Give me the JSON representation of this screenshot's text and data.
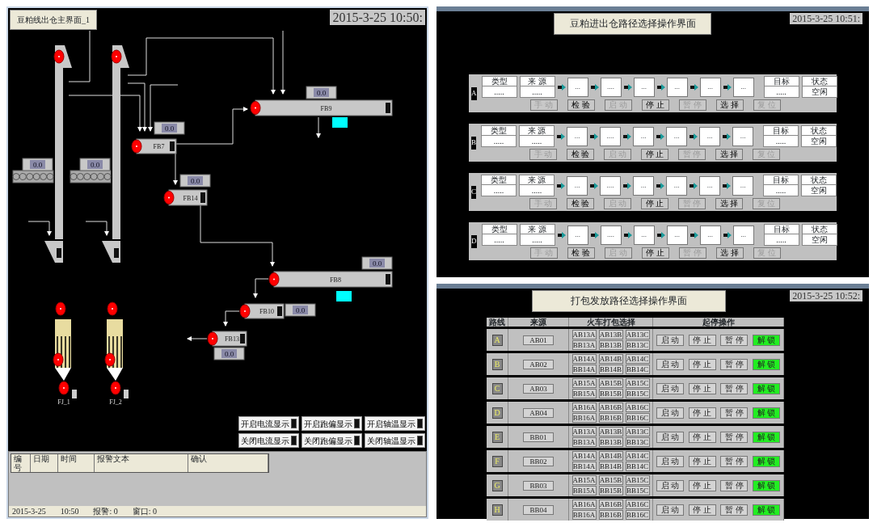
{
  "main_screen": {
    "title": "豆粕线出仓主界面_1",
    "clock": "2015-3-25 10:50:",
    "conveyors": [
      {
        "label": "FB9",
        "display": "0.0"
      },
      {
        "label": "FB7",
        "display": "0.0"
      },
      {
        "label": "FB14",
        "display": "0.0"
      },
      {
        "label": "FB8",
        "display": "0.0"
      },
      {
        "label": "FB10",
        "display": "0.0"
      },
      {
        "label": "FB13",
        "display": "0.0"
      }
    ],
    "screw_feeders": [
      {
        "display": "0.0"
      },
      {
        "display": "0.0"
      }
    ],
    "bag_filters": [
      {
        "label": "FJ_1"
      },
      {
        "label": "FJ_2"
      }
    ],
    "display_toggles": [
      "开启电流显示",
      "开启跑偏显示",
      "开启轴温显示",
      "关闭电流显示",
      "关闭跑偏显示",
      "关闭轴温显示"
    ],
    "alarm_table": {
      "columns": [
        "编号",
        "日期",
        "时间",
        "报警文本",
        "确认"
      ]
    },
    "status_bar": [
      "2015-3-25",
      "10:50",
      "报警: 0",
      "窗口: 0"
    ]
  },
  "route_panel": {
    "title": "豆粕进出仓路径选择操作界面",
    "clock": "2015-3-25 10:51:",
    "rows": [
      {
        "letter": "A",
        "type_label": "类型",
        "type_value": ".....",
        "source_label": "来 源",
        "source_value": ".....",
        "stages": [
          "...",
          "....",
          "...",
          "...",
          "...",
          "..."
        ],
        "target_label": "目标",
        "target_value": ".....",
        "status_label": "状态",
        "status_value": "空闲",
        "buttons": [
          {
            "label": "手 动",
            "disabled": true
          },
          {
            "label": "检 验",
            "disabled": false
          },
          {
            "label": "启 动",
            "disabled": true
          },
          {
            "label": "停 止",
            "disabled": false
          },
          {
            "label": "暂 停",
            "disabled": true
          },
          {
            "label": "选 择",
            "disabled": false
          },
          {
            "label": "复 位",
            "disabled": true
          }
        ]
      },
      {
        "letter": "B",
        "type_label": "类型",
        "type_value": ".....",
        "source_label": "来 源",
        "source_value": ".....",
        "stages": [
          "...",
          "....",
          "...",
          "...",
          "...",
          "..."
        ],
        "target_label": "目标",
        "target_value": ".....",
        "status_label": "状态",
        "status_value": "空闲",
        "buttons": [
          {
            "label": "手 动",
            "disabled": true
          },
          {
            "label": "检 验",
            "disabled": false
          },
          {
            "label": "启 动",
            "disabled": true
          },
          {
            "label": "停 止",
            "disabled": false
          },
          {
            "label": "暂 停",
            "disabled": true
          },
          {
            "label": "选 择",
            "disabled": false
          },
          {
            "label": "复 位",
            "disabled": true
          }
        ]
      },
      {
        "letter": "C",
        "type_label": "类型",
        "type_value": ".....",
        "source_label": "来 源",
        "source_value": ".....",
        "stages": [
          "...",
          "....",
          "...",
          "...",
          "...",
          "..."
        ],
        "target_label": "目标",
        "target_value": ".....",
        "status_label": "状态",
        "status_value": "空闲",
        "buttons": [
          {
            "label": "手 动",
            "disabled": true
          },
          {
            "label": "检 验",
            "disabled": false
          },
          {
            "label": "启 动",
            "disabled": true
          },
          {
            "label": "停 止",
            "disabled": false
          },
          {
            "label": "暂 停",
            "disabled": true
          },
          {
            "label": "选 择",
            "disabled": false
          },
          {
            "label": "复 位",
            "disabled": true
          }
        ]
      },
      {
        "letter": "D",
        "type_label": "类型",
        "type_value": ".....",
        "source_label": "来 源",
        "source_value": ".....",
        "stages": [
          "...",
          "....",
          "...",
          "...",
          "...",
          "..."
        ],
        "target_label": "目标",
        "target_value": ".....",
        "status_label": "状态",
        "status_value": "空闲",
        "buttons": [
          {
            "label": "手 动",
            "disabled": true
          },
          {
            "label": "检 验",
            "disabled": false
          },
          {
            "label": "启 动",
            "disabled": true
          },
          {
            "label": "停 止",
            "disabled": false
          },
          {
            "label": "暂 停",
            "disabled": true
          },
          {
            "label": "选 择",
            "disabled": false
          },
          {
            "label": "复 位",
            "disabled": true
          }
        ]
      }
    ]
  },
  "packing_panel": {
    "title": "打包发放路径选择操作界面",
    "clock": "2015-3-25 10:52:",
    "columns": [
      "路线",
      "来源",
      "火车打包选择",
      "起停操作"
    ],
    "rows": [
      {
        "key": "A",
        "source": "AB01",
        "options": [
          "AB13A",
          "AB13B",
          "AB13C",
          "BB13A",
          "BB13B",
          "BB13C"
        ],
        "actions": [
          {
            "label": "启 动",
            "kind": "normal"
          },
          {
            "label": "停 止",
            "kind": "normal"
          },
          {
            "label": "暂 停",
            "kind": "normal"
          },
          {
            "label": "解 锁",
            "kind": "unlock"
          }
        ]
      },
      {
        "key": "B",
        "source": "AB02",
        "options": [
          "AB14A",
          "AB14B",
          "AB14C",
          "BB14A",
          "BB14B",
          "BB14C"
        ],
        "actions": [
          {
            "label": "启 动",
            "kind": "normal"
          },
          {
            "label": "停 止",
            "kind": "normal"
          },
          {
            "label": "暂 停",
            "kind": "normal"
          },
          {
            "label": "解 锁",
            "kind": "unlock"
          }
        ]
      },
      {
        "key": "C",
        "source": "AB03",
        "options": [
          "AB15A",
          "AB15B",
          "AB15C",
          "BB15A",
          "BB15B",
          "BB15C"
        ],
        "actions": [
          {
            "label": "启 动",
            "kind": "normal"
          },
          {
            "label": "停 止",
            "kind": "normal"
          },
          {
            "label": "暂 停",
            "kind": "normal"
          },
          {
            "label": "解 锁",
            "kind": "unlock"
          }
        ]
      },
      {
        "key": "D",
        "source": "AB04",
        "options": [
          "AB16A",
          "AB16B",
          "AB16C",
          "BB16A",
          "BB16B",
          "BB16C"
        ],
        "actions": [
          {
            "label": "启 动",
            "kind": "normal"
          },
          {
            "label": "停 止",
            "kind": "normal"
          },
          {
            "label": "暂 停",
            "kind": "normal"
          },
          {
            "label": "解 锁",
            "kind": "unlock"
          }
        ]
      },
      {
        "key": "E",
        "source": "BB01",
        "options": [
          "AB13A",
          "AB13B",
          "AB13C",
          "BB13A",
          "BB13B",
          "BB13C"
        ],
        "actions": [
          {
            "label": "启 动",
            "kind": "normal"
          },
          {
            "label": "停 止",
            "kind": "normal"
          },
          {
            "label": "暂 停",
            "kind": "normal"
          },
          {
            "label": "解 锁",
            "kind": "unlock"
          }
        ]
      },
      {
        "key": "F",
        "source": "BB02",
        "options": [
          "AB14A",
          "AB14B",
          "AB14C",
          "BB14A",
          "BB14B",
          "BB14C"
        ],
        "actions": [
          {
            "label": "启 动",
            "kind": "normal"
          },
          {
            "label": "停 止",
            "kind": "normal"
          },
          {
            "label": "暂 停",
            "kind": "normal"
          },
          {
            "label": "解 锁",
            "kind": "unlock"
          }
        ]
      },
      {
        "key": "G",
        "source": "BB03",
        "options": [
          "AB15A",
          "AB15B",
          "AB15C",
          "BB15A",
          "BB15B",
          "BB15C"
        ],
        "actions": [
          {
            "label": "启 动",
            "kind": "normal"
          },
          {
            "label": "停 止",
            "kind": "normal"
          },
          {
            "label": "暂 停",
            "kind": "normal"
          },
          {
            "label": "解 锁",
            "kind": "unlock"
          }
        ]
      },
      {
        "key": "H",
        "source": "BB04",
        "options": [
          "AB16A",
          "AB16B",
          "AB16C",
          "BB16A",
          "BB16B",
          "BB16C"
        ],
        "actions": [
          {
            "label": "启 动",
            "kind": "normal"
          },
          {
            "label": "停 止",
            "kind": "normal"
          },
          {
            "label": "暂 停",
            "kind": "normal"
          },
          {
            "label": "解 锁",
            "kind": "unlock"
          }
        ]
      }
    ]
  }
}
